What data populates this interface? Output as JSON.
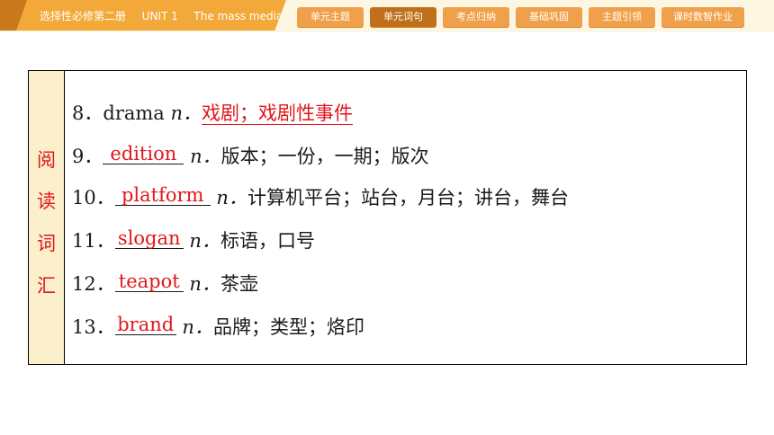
{
  "header": {
    "course_prefix": "选择性必修第二册",
    "unit": "UNIT 1",
    "unit_title": "The mass media",
    "tabs": [
      "单元主题",
      "单元词句",
      "考点归纳",
      "基础巩固",
      "主题引领",
      "课时数智作业"
    ],
    "active_tab": "单元词句"
  },
  "section": {
    "label_chars": [
      "阅",
      "读",
      "词",
      "汇"
    ]
  },
  "items": [
    {
      "num": "8．",
      "word": "drama",
      "pos": "n．",
      "answer": "戏剧；戏剧性事件",
      "meaning": ""
    },
    {
      "num": "9．",
      "word": "",
      "pos": "n．",
      "answer": "edition",
      "meaning": "版本；一份，一期；版次"
    },
    {
      "num": "10．",
      "word": "",
      "pos": "n．",
      "answer": "platform",
      "meaning": "计算机平台；站台，月台；讲台，舞台"
    },
    {
      "num": "11．",
      "word": "",
      "pos": "n．",
      "answer": "slogan",
      "meaning": "标语，口号"
    },
    {
      "num": "12．",
      "word": "",
      "pos": "n．",
      "answer": "teapot",
      "meaning": "茶壶"
    },
    {
      "num": "13．",
      "word": "",
      "pos": "n．",
      "answer": "brand",
      "meaning": "品牌；类型；烙印"
    }
  ],
  "colors": {
    "accent": "#f3a93a",
    "active_tab": "#c0701b",
    "answer": "#e0161b",
    "side_bg": "#fcefcc"
  }
}
